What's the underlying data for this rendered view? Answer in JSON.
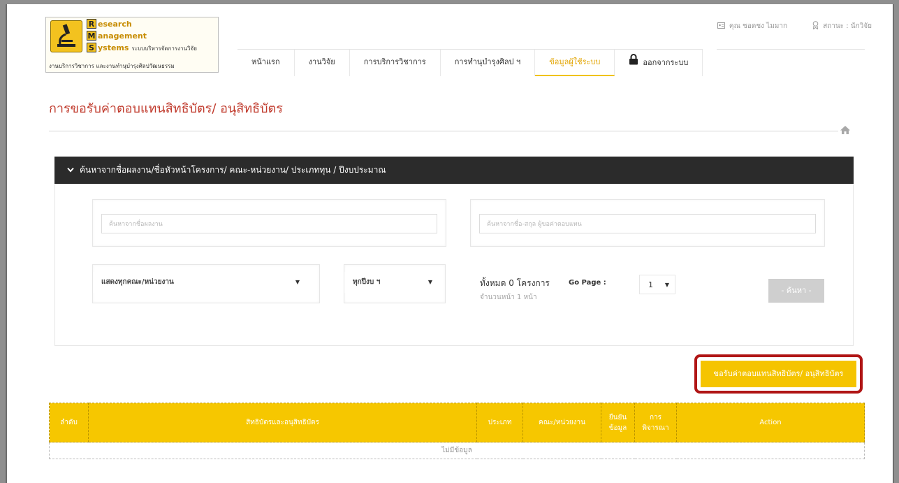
{
  "header": {
    "logo": {
      "line1_cap": "R",
      "line1_rest": "esearch",
      "line2_cap": "M",
      "line2_rest": "anagement",
      "line3_cap": "S",
      "line3_rest": "ystems",
      "line3_small": "ระบบบริหารจัดการงานวิจัย",
      "subtitle": "งานบริการวิชาการ และงานทำนุบำรุงศิลปวัฒนธรรม"
    },
    "user_name": "คุณ ชอดชง ไมมาก",
    "user_status": "สถานะ : นักวิจัย"
  },
  "nav": {
    "items": [
      {
        "label": "หน้าแรก"
      },
      {
        "label": "งานวิจัย"
      },
      {
        "label": "การบริการวิชาการ"
      },
      {
        "label": "การทำนุบำรุงศิลป ฯ"
      },
      {
        "label": "ข้อมูลผู้ใช้ระบบ"
      }
    ],
    "logout_label": "ออกจากระบบ",
    "active_color": "#e2a400"
  },
  "page": {
    "title": "การขอรับค่าตอบแทนสิทธิบัตร/ อนุสิทธิบัตร",
    "title_color": "#c0392b"
  },
  "search": {
    "header": "ค้นหาจากชื่อผลงาน/ชื่อหัวหน้าโครงการ/ คณะ-หน่วยงาน/ ประเภททุน / ปีงบประมาณ",
    "work_placeholder": "ค้นหาจากชื่อผลงาน",
    "name_placeholder": "ค้นหาจากชื่อ-สกุล ผู้ขอค่าตอบแทน",
    "faculty_select": "แสดงทุกคณะ/หน่วยงาน",
    "year_select": "ทุกปีงบ ฯ",
    "total_label": "ทั้งหมด 0 โครงการ",
    "page_count": "จำนวนหน้า 1 หน้า",
    "go_page_label": "Go Page :",
    "go_page_value": "1",
    "search_button": "- ค้นหา -"
  },
  "actions": {
    "request_button": "ขอรับค่าตอบแทนสิทธิบัตร/ อนุสิทธิบัตร",
    "accent_color": "#f5c400",
    "highlight_color": "#b01515"
  },
  "table": {
    "columns": [
      "ลำดับ",
      "สิทธิบัตรและอนุสิทธิบัตร",
      "ประเภท",
      "คณะ/หน่วยงาน",
      "ยืนยันข้อมูล",
      "การพิจารณา",
      "Action"
    ],
    "empty_message": "ไม่มีข้อมูล",
    "header_color": "#f6c700"
  }
}
